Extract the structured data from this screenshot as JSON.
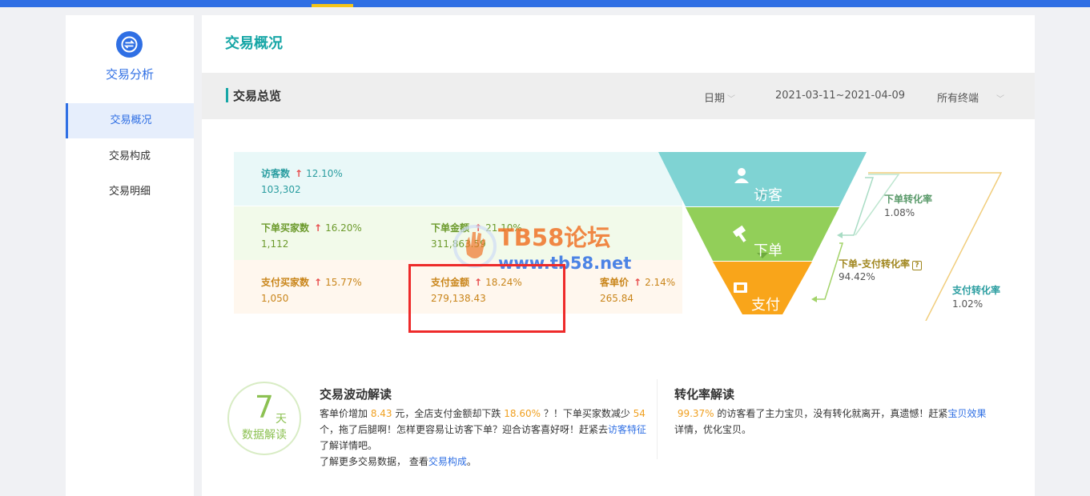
{
  "sidebar": {
    "icon": "swap-arrows-icon",
    "title": "交易分析",
    "items": [
      {
        "label": "交易概况",
        "active": true
      },
      {
        "label": "交易构成",
        "active": false
      },
      {
        "label": "交易明细",
        "active": false
      }
    ]
  },
  "main": {
    "page_title": "交易概况",
    "section_title": "交易总览",
    "filters": {
      "date_label": "日期",
      "date_range": "2021-03-11~2021-04-09",
      "terminal_label": "所有终端"
    }
  },
  "funnel": {
    "visitor_row": [
      {
        "label": "访客数",
        "rate": "12.10%",
        "value": "103,302"
      }
    ],
    "order_row": [
      {
        "label": "下单买家数",
        "rate": "16.20%",
        "value": "1,112"
      },
      {
        "label": "下单金额",
        "rate": "21.10%",
        "value": "311,863.59"
      }
    ],
    "pay_row": [
      {
        "label": "支付买家数",
        "rate": "15.77%",
        "value": "1,050"
      },
      {
        "label": "支付金额",
        "rate": "18.24%",
        "value": "279,138.43"
      },
      {
        "label": "客单价",
        "rate": "2.14%",
        "value": "265.84"
      }
    ],
    "stages": [
      "访客",
      "下单",
      "支付"
    ],
    "conversions": {
      "order_rate_label": "下单转化率",
      "order_rate_value": "1.08%",
      "order_pay_label": "下单-支付转化率",
      "order_pay_value": "94.42%",
      "pay_rate_label": "支付转化率",
      "pay_rate_value": "1.02%"
    },
    "colors": {
      "visitor": "#7fd3d3",
      "order": "#92cf59",
      "pay": "#f9a51a"
    }
  },
  "watermark": {
    "title": "TB58论坛",
    "url": "www.tb58.net"
  },
  "badge": {
    "number": "7",
    "unit": "天",
    "text": "数据解读"
  },
  "fluctuation": {
    "title": "交易波动解读",
    "p1": "客单价增加",
    "v1": "8.43",
    "p2": "元，全店支付金额却下跌",
    "v2": "18.60%",
    "p3": "？！下单买家数减少",
    "v3": "54",
    "p4": "个，拖了后腿啊！怎样更容易让访客下单？迎合访客喜好呀！赶紧去",
    "link1": "访客特征",
    "p5": "了解详情吧。",
    "p6": "了解更多交易数据， 查看",
    "link2": "交易构成",
    "p7": "。"
  },
  "conversion": {
    "title": "转化率解读",
    "v1": "99.37%",
    "p1": "的访客看了主力宝贝，没有转化就离开，真遗憾！赶紧",
    "link1": "宝贝效果",
    "p2": "详情，优化宝贝。"
  }
}
